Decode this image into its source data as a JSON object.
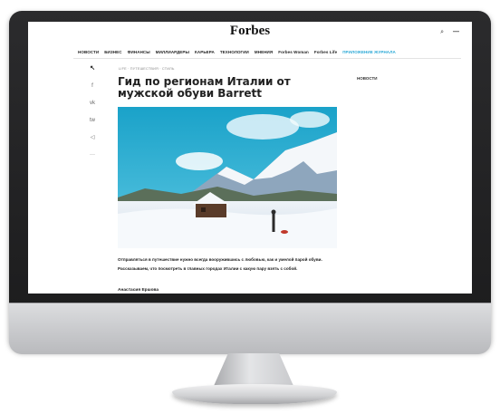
{
  "header": {
    "logo": "Forbes",
    "right_icons": {
      "search": "⌕",
      "menu": "—"
    }
  },
  "nav": {
    "items": [
      {
        "label": "НОВОСТИ"
      },
      {
        "label": "БИЗНЕС"
      },
      {
        "label": "ФИНАНСЫ"
      },
      {
        "label": "МИЛЛИАРДЕРЫ"
      },
      {
        "label": "КАРЬЕРА"
      },
      {
        "label": "ТЕХНОЛОГИИ"
      },
      {
        "label": "МНЕНИЯ"
      },
      {
        "label": "Forbes Woman"
      },
      {
        "label": "Forbes Life"
      },
      {
        "label": "ПРИЛОЖЕНИЕ ЖУРНАЛА",
        "accent": true
      }
    ],
    "accent_color": "#2aa8d6"
  },
  "share": {
    "icons": [
      {
        "name": "share-icon",
        "glyph": "↖"
      },
      {
        "name": "facebook-icon",
        "glyph": "f"
      },
      {
        "name": "vk-icon",
        "glyph": "vk"
      },
      {
        "name": "twitter-icon",
        "glyph": "tw"
      },
      {
        "name": "telegram-icon",
        "glyph": "◁"
      },
      {
        "name": "more-icon",
        "glyph": "···"
      }
    ]
  },
  "article": {
    "breadcrumb": "LIFE · ПУТЕШЕСТВИЯ · СТИЛЬ",
    "title": "Гид по регионам Италии от мужской обуви Barrett",
    "lead": "Отправляться в путешествие нужно всегда вооружившись с любовью, как и умелой парой обуви. Рассказываем, что посмотреть в главных городах Италии с какую пару взять с собой.",
    "author": "Анастасия Ершова"
  },
  "sidebar": {
    "label": "НОВОСТИ"
  }
}
